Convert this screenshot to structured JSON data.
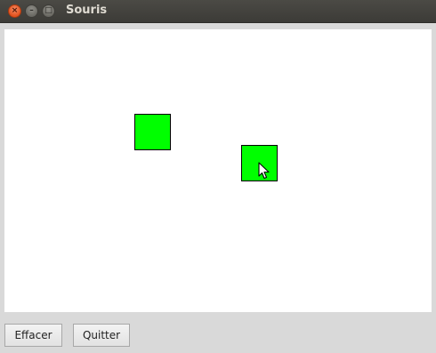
{
  "window": {
    "title": "Souris",
    "close_glyph": "×",
    "minimize_glyph": "–",
    "maximize_glyph": "□"
  },
  "canvas": {
    "background": "#ffffff",
    "square_color": "#00ff00",
    "square_border": "#000000",
    "cursor_icon": "arrow-pointer-icon"
  },
  "buttons": {
    "clear_label": "Effacer",
    "quit_label": "Quitter"
  }
}
